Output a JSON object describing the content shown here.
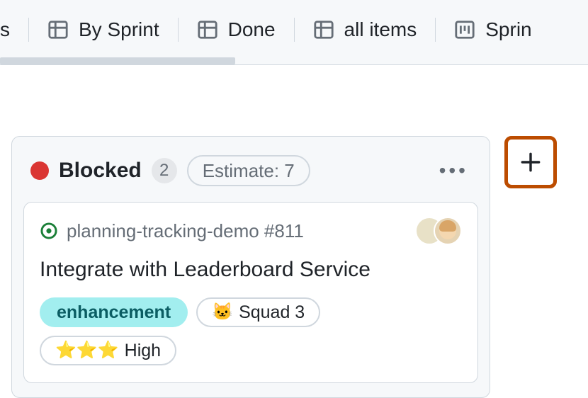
{
  "tabs": {
    "truncated_left": "s",
    "items": [
      {
        "label": "By Sprint",
        "icon": "table"
      },
      {
        "label": "Done",
        "icon": "table"
      },
      {
        "label": "all items",
        "icon": "table"
      },
      {
        "label": "Sprin",
        "icon": "board"
      }
    ]
  },
  "column": {
    "status_color": "#da3633",
    "title": "Blocked",
    "count": "2",
    "estimate_label": "Estimate: 7"
  },
  "card": {
    "repo_ref": "planning-tracking-demo #811",
    "title": "Integrate with Leaderboard Service",
    "labels": {
      "enhancement": "enhancement",
      "squad_emoji": "🐱",
      "squad_text": "Squad 3",
      "priority_emoji": "⭐⭐⭐",
      "priority_text": "High"
    },
    "assignees_count": 2
  }
}
